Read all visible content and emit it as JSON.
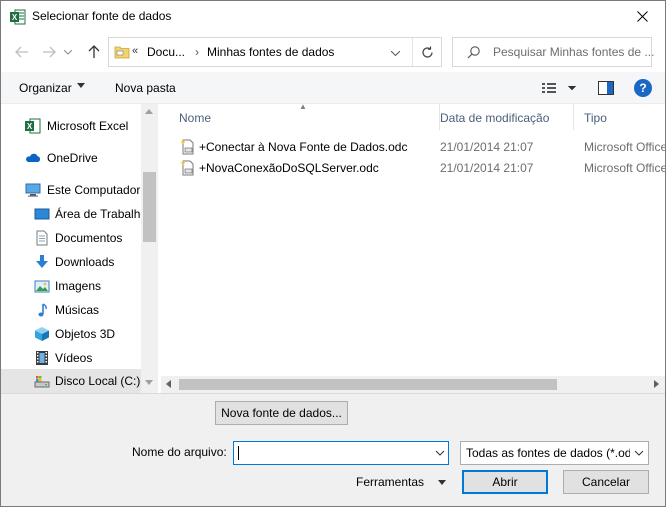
{
  "window": {
    "title": "Selecionar fonte de dados",
    "app_icon": "excel-icon",
    "close_icon": "close-icon"
  },
  "address_bar": {
    "overflow_chevron": "«",
    "segments": [
      "Docu...",
      "Minhas fontes de dados"
    ],
    "separator": "›"
  },
  "search": {
    "placeholder": "Pesquisar Minhas fontes de ..."
  },
  "toolbar": {
    "organize_label": "Organizar",
    "new_folder_label": "Nova pasta",
    "help_label": "?"
  },
  "sidebar": {
    "items": [
      {
        "label": "Microsoft Excel",
        "icon": "excel-icon"
      },
      {
        "label": "OneDrive",
        "icon": "cloud-icon"
      },
      {
        "label": "Este Computador",
        "icon": "computer-icon"
      },
      {
        "label": "Área de Trabalho",
        "icon": "desktop-icon"
      },
      {
        "label": "Documentos",
        "icon": "document-icon"
      },
      {
        "label": "Downloads",
        "icon": "download-icon"
      },
      {
        "label": "Imagens",
        "icon": "image-icon"
      },
      {
        "label": "Músicas",
        "icon": "music-icon"
      },
      {
        "label": "Objetos 3D",
        "icon": "cube-icon"
      },
      {
        "label": "Vídeos",
        "icon": "video-icon"
      },
      {
        "label": "Disco Local (C:)",
        "icon": "drive-icon"
      }
    ]
  },
  "file_list": {
    "columns": [
      "Nome",
      "Data de modificação",
      "Tipo"
    ],
    "rows": [
      {
        "name": "+Conectar à Nova Fonte de Dados.odc",
        "modified": "21/01/2014 21:07",
        "type": "Microsoft Office"
      },
      {
        "name": "+NovaConexãoDoSQLServer.odc",
        "modified": "21/01/2014 21:07",
        "type": "Microsoft Office"
      }
    ]
  },
  "bottom": {
    "new_source_button": "Nova fonte de dados...",
    "filename_label": "Nome do arquivo:",
    "filename_value": "",
    "filter_value": "Todas as fontes de dados (*.odc",
    "tools_label": "Ferramentas",
    "open_button": "Abrir",
    "cancel_button": "Cancelar"
  },
  "colors": {
    "accent": "#0078d7",
    "excel_green": "#1d6f42",
    "help_blue": "#1a67c4"
  }
}
